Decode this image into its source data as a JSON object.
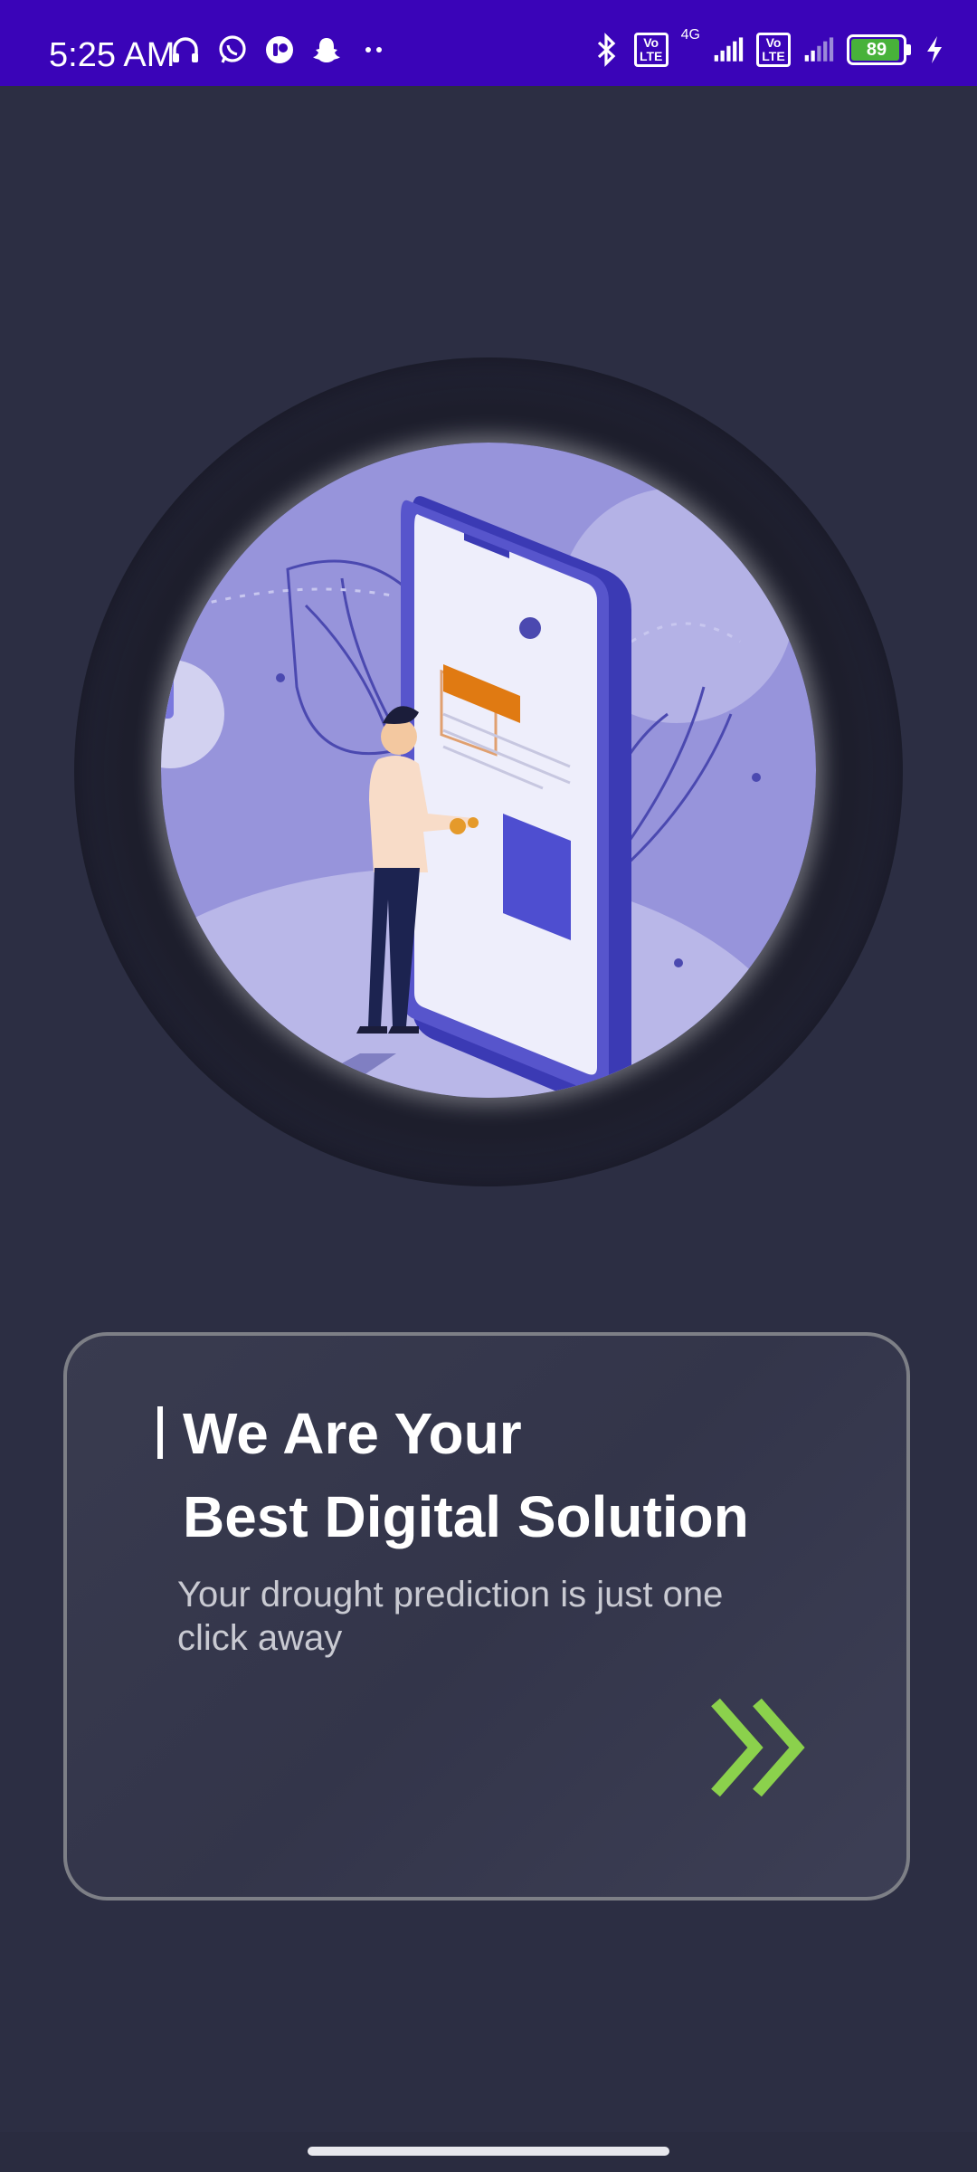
{
  "status_bar": {
    "time": "5:25 AM",
    "network": "4G",
    "volte_label": "Vo\nLTE",
    "battery_level": "89",
    "icons_left": [
      "headphones-icon",
      "whatsapp-icon",
      "app-icon",
      "snapchat-icon",
      "more-dots-icon"
    ],
    "icons_right": [
      "bluetooth-icon",
      "volte-icon",
      "signal-icon",
      "volte-icon",
      "signal-icon",
      "battery-icon",
      "charging-icon"
    ]
  },
  "onboarding": {
    "illustration": "person-with-giant-phone-illustration",
    "headline_line1": "We Are Your",
    "headline_line2": "Best Digital Solution",
    "subtitle": "Your drought prediction is just one click away",
    "next_icon": "double-chevron-right-icon"
  },
  "colors": {
    "status_bar": "#3a04b8",
    "background": "#2c2e43",
    "accent": "#8bd14c",
    "card_border": "#7d7f86"
  }
}
